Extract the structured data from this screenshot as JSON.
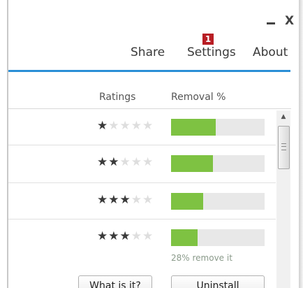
{
  "window": {
    "minimize_icon": "minimize-icon",
    "close_label": "X"
  },
  "nav": {
    "share": "Share",
    "settings": "Settings",
    "about": "About",
    "settings_badge": "1",
    "badge_color": "#b81d24",
    "accent_color": "#2b8fd6"
  },
  "table": {
    "columns": {
      "ratings": "Ratings",
      "removal": "Removal %"
    },
    "rows": [
      {
        "rating": 1,
        "max_rating": 5,
        "removal_fraction": 0.48
      },
      {
        "rating": 2,
        "max_rating": 5,
        "removal_fraction": 0.45
      },
      {
        "rating": 3,
        "max_rating": 5,
        "removal_fraction": 0.34
      },
      {
        "rating": 3,
        "max_rating": 5,
        "removal_fraction": 0.28
      }
    ],
    "removal_caption": "28% remove it",
    "bar_fill_color": "#7ec242"
  },
  "buttons": {
    "what_is_it": "What is it?",
    "uninstall": "Uninstall"
  }
}
